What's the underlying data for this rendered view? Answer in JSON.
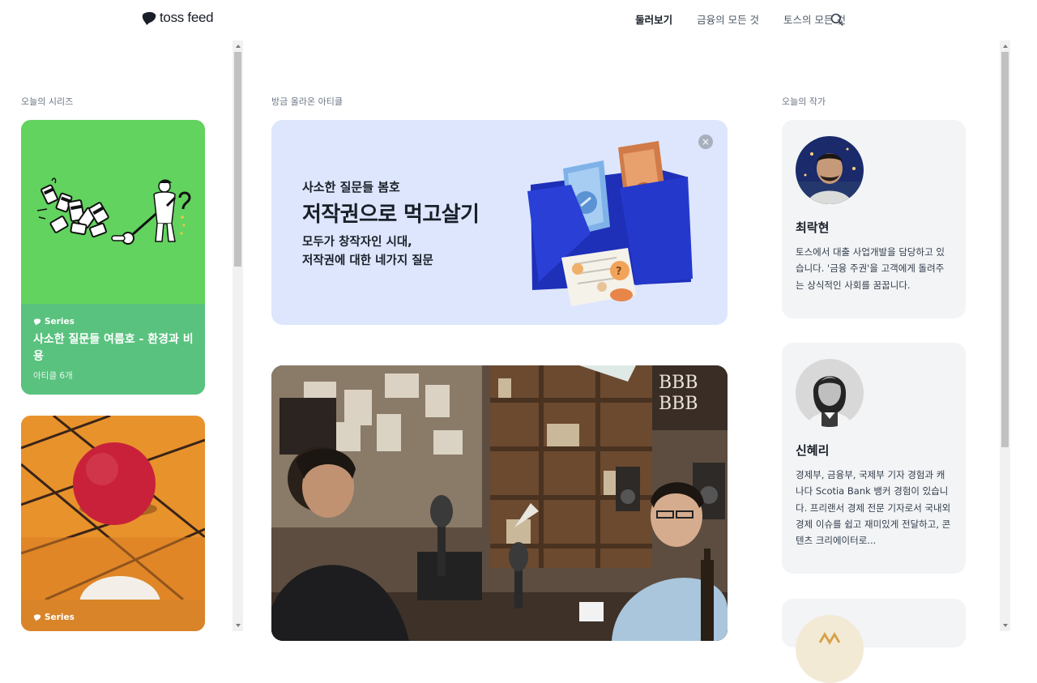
{
  "header": {
    "logo_text": "toss feed",
    "nav": [
      "둘러보기",
      "금융의 모든 것",
      "토스의 모든 것"
    ],
    "active_nav": "둘러보기",
    "search_icon": "search-icon"
  },
  "sections": {
    "series_title": "오늘의 시리즈",
    "articles_title": "방금 올라온 아티클",
    "authors_title": "오늘의 작가"
  },
  "series": [
    {
      "badge": "Series",
      "name": "사소한 질문들 여름호 - 환경과 비용",
      "count": "아티클 6개",
      "color": "#62d35e"
    },
    {
      "badge": "Series",
      "name": "",
      "count": "",
      "color": "#ed9a33"
    }
  ],
  "banner": {
    "eyebrow": "사소한 질문들 봄호",
    "title": "저작권으로 먹고살기",
    "desc_line1": "모두가 창작자인 시대,",
    "desc_line2": "저작권에 대한 네가지 질문",
    "close_label": "×",
    "background": "#dde6fc"
  },
  "authors": [
    {
      "name": "최락현",
      "bio": "토스에서 대출 사업개발을 담당하고 있습니다. '금융 주권'을 고객에게 돌려주는 상식적인 사회를 꿈꿉니다."
    },
    {
      "name": "신혜리",
      "bio": "경제부, 금융부, 국제부 기자 경험과 캐나다 Scotia Bank 뱅커 경험이 있습니다. 프리랜서 경제 전문 기자로서 국내외 경제 이슈를 쉽고 재미있게 전달하고, 콘텐츠 크리에이터로..."
    }
  ]
}
